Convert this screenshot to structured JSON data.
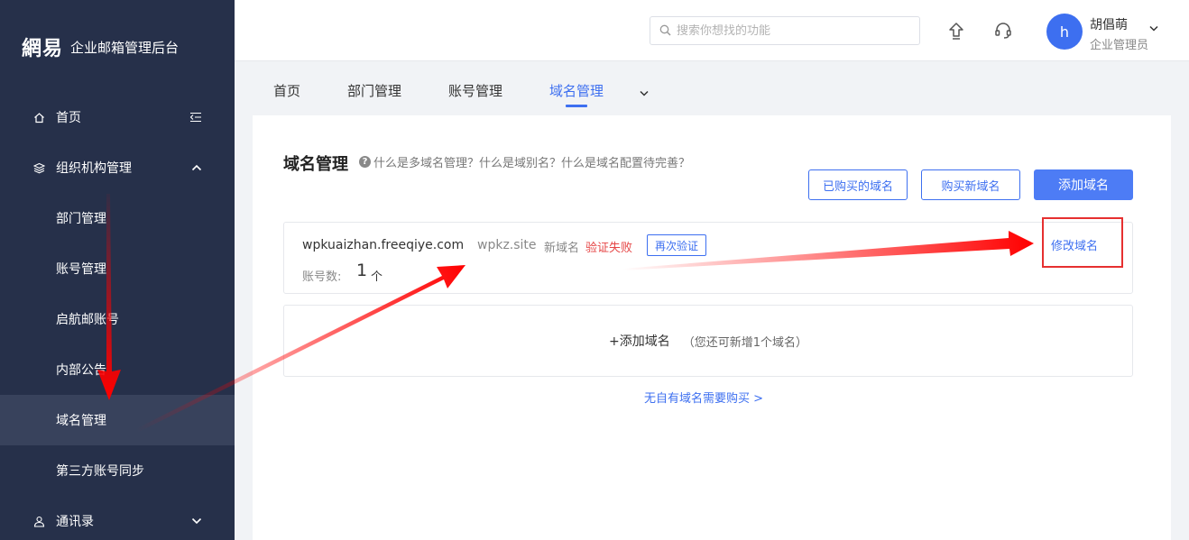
{
  "brand": {
    "logo": "網易",
    "title": "企业邮箱管理后台"
  },
  "sidebar": {
    "items": [
      {
        "label": "首页"
      },
      {
        "label": "组织机构管理"
      },
      {
        "label": "部门管理"
      },
      {
        "label": "账号管理"
      },
      {
        "label": "启航邮账号"
      },
      {
        "label": "内部公告"
      },
      {
        "label": "域名管理"
      },
      {
        "label": "第三方账号同步"
      },
      {
        "label": "通讯录"
      }
    ]
  },
  "header": {
    "search_placeholder": "搜索你想找的功能",
    "avatar_letter": "h",
    "user_name": "胡倡萌",
    "user_role": "企业管理员"
  },
  "tabs": [
    {
      "label": "首页"
    },
    {
      "label": "部门管理"
    },
    {
      "label": "账号管理"
    },
    {
      "label": "域名管理"
    }
  ],
  "main": {
    "title": "域名管理",
    "help_text": "什么是多域名管理？什么是域别名？什么是域名配置待完善？",
    "buttons": {
      "purchased": "已购买的域名",
      "buy_new": "购买新域名",
      "add": "添加域名"
    },
    "domain": {
      "name": "wpkuaizhan.freeqiye.com",
      "alias": "wpkz.site",
      "status": "新域名",
      "status_fail": "验证失败",
      "reverify": "再次验证",
      "account_label": "账号数:",
      "account_count": "1",
      "account_unit": "个",
      "modify": "修改域名"
    },
    "add_domain": "+添加域名",
    "add_hint": "（您还可新增1个域名）",
    "buy_link": "无自有域名需要购买 >"
  },
  "colors": {
    "sidebar_bg": "#26304a",
    "accent": "#3d6ff0",
    "error": "#e54545",
    "annotation": "#e63030"
  }
}
